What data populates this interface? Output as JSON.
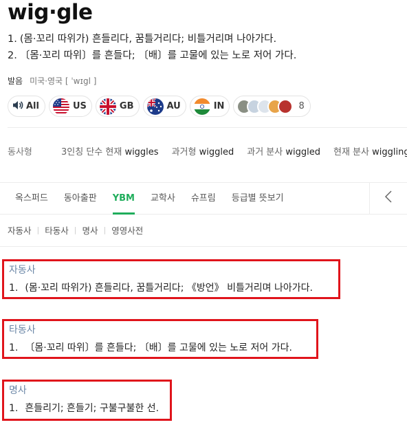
{
  "entry": {
    "headword": "wig·gle",
    "summary": [
      {
        "num": "1.",
        "text": "(몸·꼬리 따위가) 흔들리다, 꿈틀거리다; 비틀거리며 나아가다."
      },
      {
        "num": "2.",
        "text": "〔몸·꼬리 따위〕를 흔들다; 〔배〕를 고물에 있는 노로 저어 가다."
      }
    ],
    "pronunciation": {
      "label": "발음",
      "value": "미국·영국 [ ˈwɪgl ]"
    }
  },
  "audio": {
    "all_label": "All",
    "accents": [
      {
        "code": "US",
        "icon": "us-flag-icon"
      },
      {
        "code": "GB",
        "icon": "uk-flag-icon"
      },
      {
        "code": "AU",
        "icon": "au-flag-icon"
      },
      {
        "code": "IN",
        "icon": "india-flag-icon"
      }
    ],
    "more_count": "8"
  },
  "verb_forms": {
    "title": "동사형",
    "items": [
      {
        "label": "3인칭 단수 현재",
        "value": "wiggles"
      },
      {
        "label": "과거형",
        "value": "wiggled"
      },
      {
        "label": "과거 분사",
        "value": "wiggled"
      },
      {
        "label": "현재 분사",
        "value": "wiggling"
      }
    ]
  },
  "dictionary_tabs": [
    "옥스퍼드",
    "동아출판",
    "YBM",
    "교학사",
    "슈프림",
    "등급별 뜻보기"
  ],
  "active_tab": "YBM",
  "pos_tabs": [
    "자동사",
    "타동사",
    "명사",
    "영영사전"
  ],
  "senses": [
    {
      "pos": "자동사",
      "num": "1.",
      "definition": "(몸·꼬리 따위가) 흔들리다, 꿈틀거리다; 《방언》 비틀거리며 나아가다."
    },
    {
      "pos": "타동사",
      "num": "1.",
      "definition": "〔몸·꼬리 따위〕를 흔들다; 〔배〕를 고물에 있는 노로 저어 가다."
    },
    {
      "pos": "명사",
      "num": "1.",
      "definition": "흔들리기; 흔들기; 구불구불한 선."
    }
  ],
  "colors": {
    "accent": "#1fad5b",
    "highlight_border": "#e0141b",
    "pos_label": "#6b87a7"
  }
}
